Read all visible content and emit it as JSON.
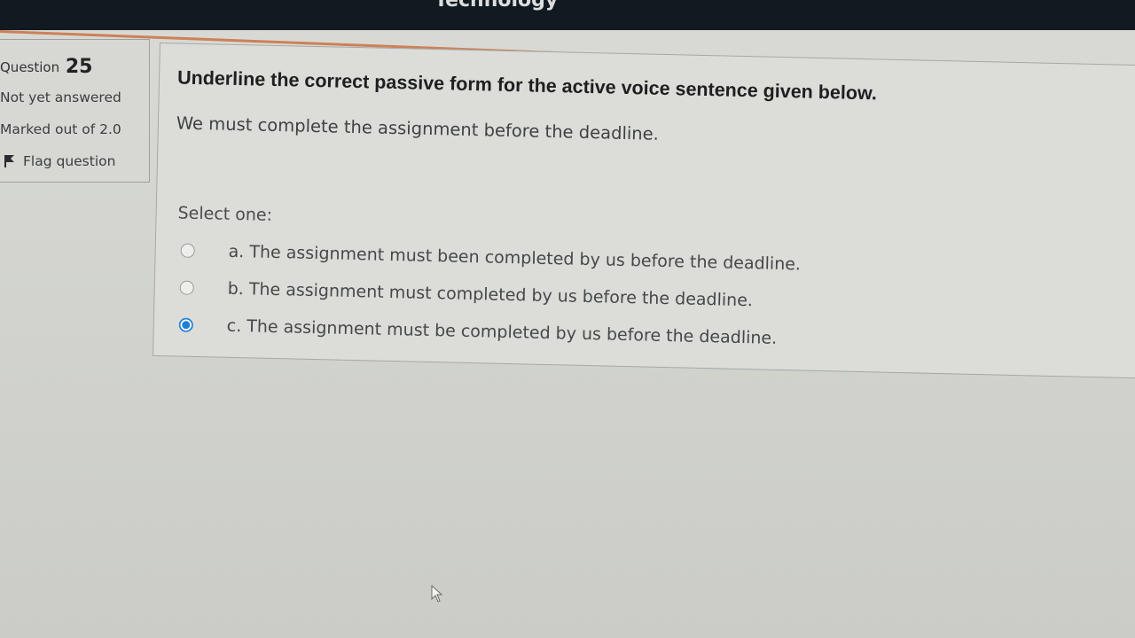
{
  "header": {
    "title_fragment": "Technology"
  },
  "question_info": {
    "label": "Question",
    "number": "25",
    "status": "Not yet answered",
    "marks": "Marked out of 2.0",
    "flag_label": "Flag question"
  },
  "question": {
    "instruction": "Underline the correct passive form for the active voice sentence given below.",
    "sentence": "We must complete the assignment before the deadline.",
    "select_label": "Select one:",
    "options": [
      {
        "label": "a. The assignment must been completed by us before the deadline.",
        "selected": false
      },
      {
        "label": "b. The assignment must completed by us before the deadline.",
        "selected": false
      },
      {
        "label": "c. The assignment must be completed by us before the deadline.",
        "selected": true
      }
    ]
  },
  "colors": {
    "topbar": "#121a21",
    "accent": "#c96a3a",
    "radio_selected": "#1f7fd6"
  },
  "icons": {
    "flag": "flag-icon",
    "cursor": "mouse-pointer-icon"
  }
}
